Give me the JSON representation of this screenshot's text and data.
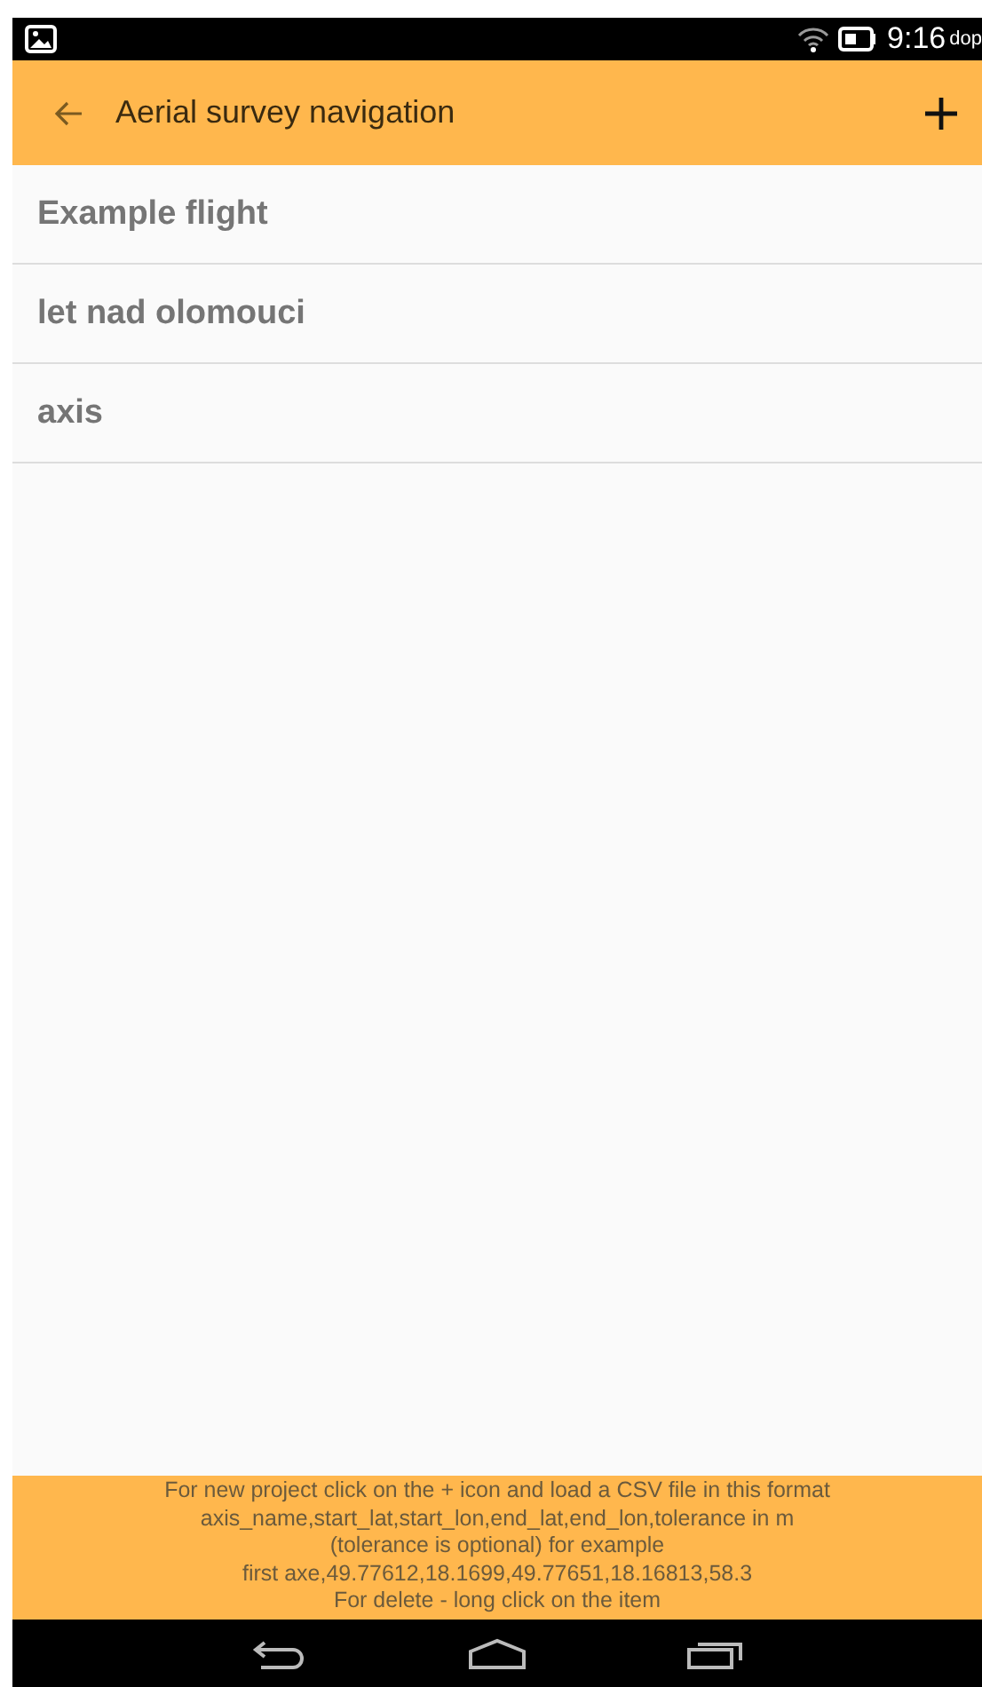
{
  "status_bar": {
    "time": "9:16",
    "time_suffix": "dop"
  },
  "app_bar": {
    "title": "Aerial survey navigation"
  },
  "items": [
    {
      "label": "Example flight"
    },
    {
      "label": "let nad olomouci"
    },
    {
      "label": "axis"
    }
  ],
  "footer": {
    "lines": [
      "For new project click on the + icon and load a CSV file in this format",
      "axis_name,start_lat,start_lon,end_lat,end_lon,tolerance in m",
      "(tolerance is optional) for example",
      "first axe,49.77612,18.1699,49.77651,18.16813,58.3",
      "For delete - long click on the item"
    ]
  }
}
